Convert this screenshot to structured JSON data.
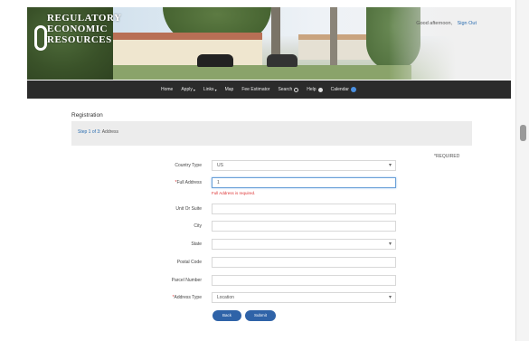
{
  "header": {
    "logo_lines": [
      "REGULATORY",
      "ECONOMIC",
      "RESOURCES"
    ],
    "greeting": "Good afternoon,",
    "signout_label": "Sign Out"
  },
  "nav": {
    "items": [
      {
        "label": "Home"
      },
      {
        "label": "Apply",
        "caret": "▾"
      },
      {
        "label": "Links",
        "caret": "▾"
      },
      {
        "label": "Map"
      },
      {
        "label": "Fee Estimator"
      },
      {
        "label": "Search",
        "icon": "search-icon"
      },
      {
        "label": "Help",
        "icon": "help-icon"
      },
      {
        "label": "Calendar",
        "icon": "calendar-icon"
      }
    ]
  },
  "page": {
    "title": "Registration",
    "breadcrumb_link": "Step 1 of 3:",
    "breadcrumb_current": "Address",
    "required_note": "*REQUIRED"
  },
  "form": {
    "country_type": {
      "label": "Country Type",
      "value": "US"
    },
    "full_address": {
      "label": "Full Address",
      "value": "1",
      "error": "Full Address is required."
    },
    "unit_or_suite": {
      "label": "Unit Or Suite",
      "value": ""
    },
    "city": {
      "label": "City",
      "value": ""
    },
    "state": {
      "label": "State",
      "value": ""
    },
    "postal_code": {
      "label": "Postal Code",
      "value": ""
    },
    "parcel_number": {
      "label": "Parcel Number",
      "value": ""
    },
    "address_type": {
      "label": "Address Type",
      "value": "Location"
    },
    "back_label": "Back",
    "submit_label": "Submit"
  },
  "colors": {
    "nav_bg": "#2b2b2b",
    "primary_button": "#2f63a8",
    "error_text": "#dd3333",
    "link": "#2a6db0"
  }
}
